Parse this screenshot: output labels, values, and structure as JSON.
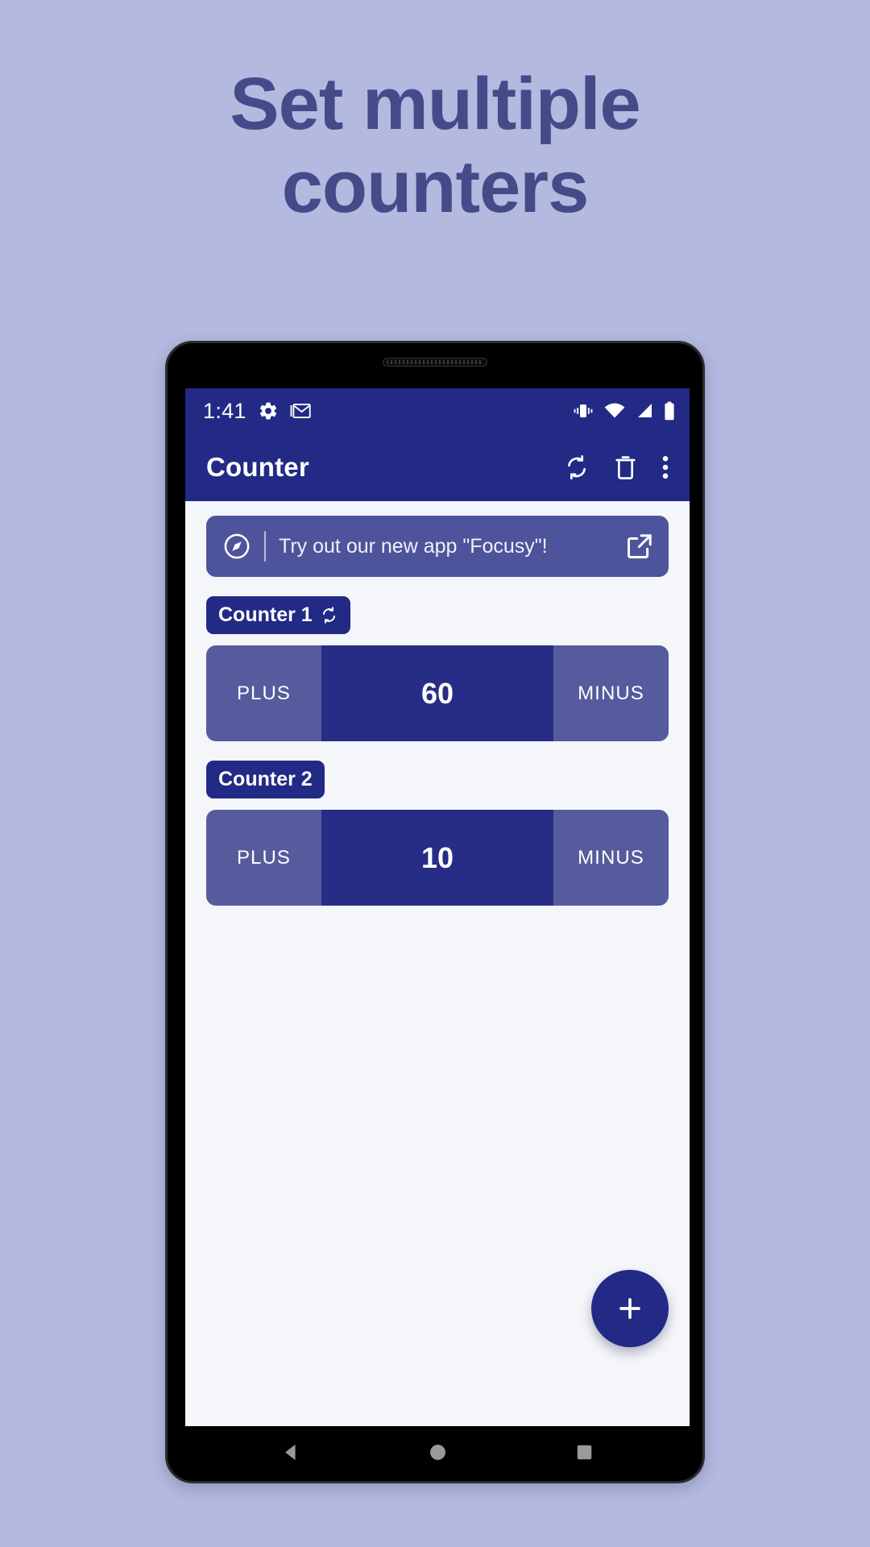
{
  "promo_headline": {
    "line1": "Set multiple",
    "line2": "counters"
  },
  "theme": {
    "page_background": "#b4b9e0",
    "headline_color": "#454b89",
    "primary_navy": "#222a85",
    "value_navy": "#272d86",
    "button_muted": "#555b9c",
    "banner_bg": "#4e549b",
    "screen_bg": "#f5f6fa"
  },
  "status_bar": {
    "time": "1:41",
    "left_icons": [
      "gear-icon",
      "gmail-icon"
    ],
    "right_icons": [
      "vibrate-icon",
      "wifi-icon",
      "cell-signal-icon",
      "battery-icon"
    ]
  },
  "app_bar": {
    "title": "Counter",
    "actions": [
      {
        "name": "reset-all-icon",
        "label": "Reset all"
      },
      {
        "name": "delete-all-icon",
        "label": "Delete all"
      },
      {
        "name": "overflow-menu-icon",
        "label": "More options"
      }
    ]
  },
  "banner": {
    "icon": "compass-icon",
    "text": "Try out our new app \"Focusy\"!",
    "action_icon": "open-in-new-icon"
  },
  "counters": [
    {
      "label": "Counter 1",
      "has_reset_icon": true,
      "plus_label": "PLUS",
      "value": "60",
      "minus_label": "MINUS"
    },
    {
      "label": "Counter 2",
      "has_reset_icon": false,
      "plus_label": "PLUS",
      "value": "10",
      "minus_label": "MINUS"
    }
  ],
  "fab": {
    "icon": "plus-icon",
    "label": "Add counter"
  },
  "nav_bar": {
    "back": "back-triangle-icon",
    "home": "home-circle-icon",
    "recents": "recents-square-icon"
  }
}
